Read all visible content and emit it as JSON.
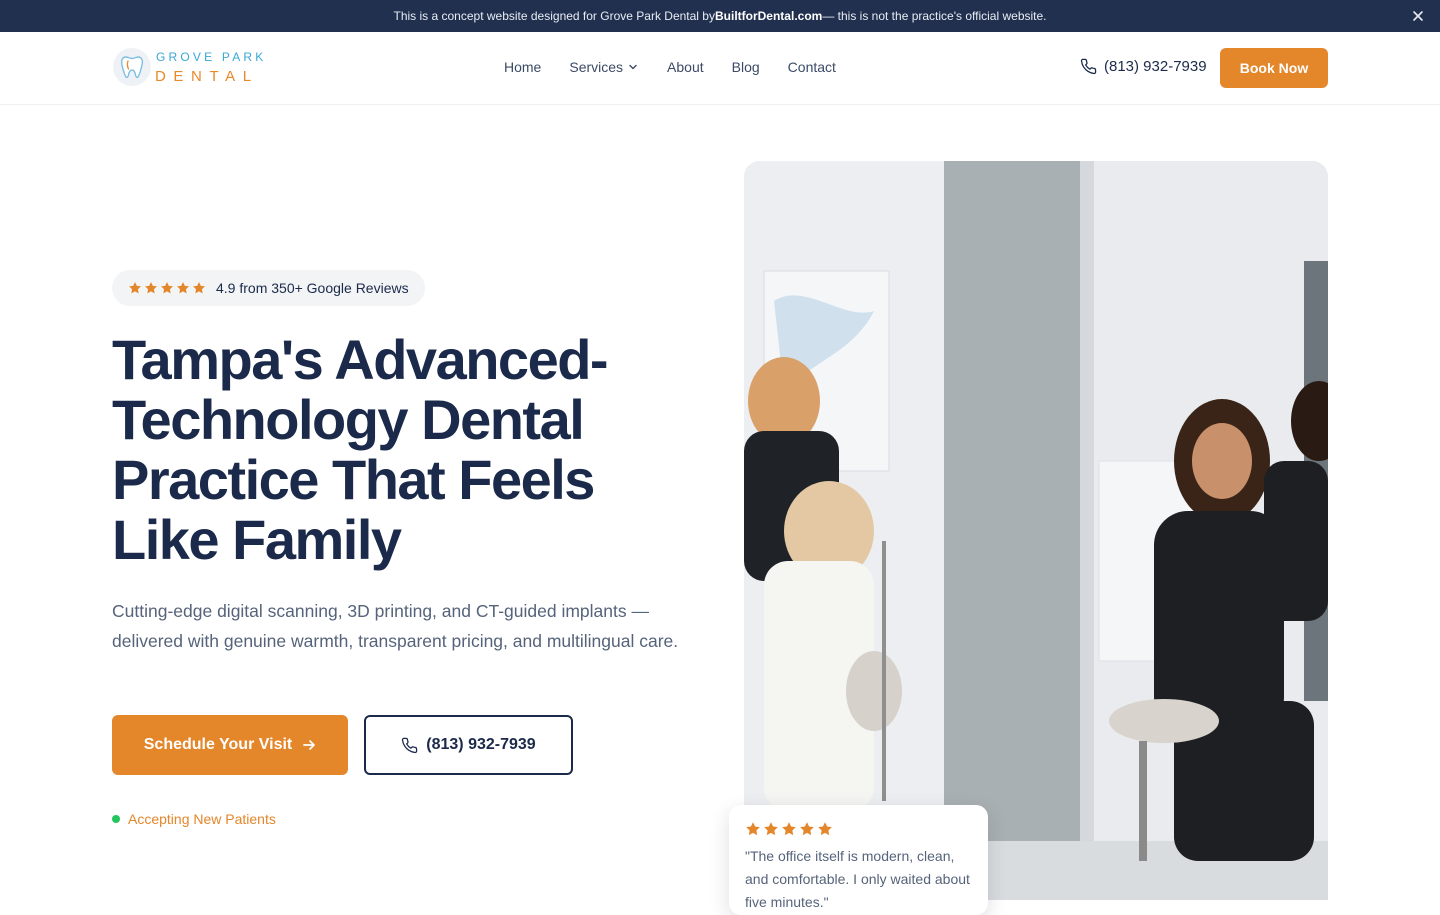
{
  "banner": {
    "text_before": "This is a concept website designed for Grove Park Dental by ",
    "brand": "BuiltforDental.com",
    "text_after": " — this is not the practice's official website."
  },
  "logo": {
    "top": "GROVE PARK",
    "bottom": "DENTAL"
  },
  "nav": {
    "items": [
      "Home",
      "Services",
      "About",
      "Blog",
      "Contact"
    ]
  },
  "header": {
    "phone": "(813) 932-7939",
    "book_label": "Book Now"
  },
  "hero": {
    "rating_text": "4.9 from 350+ Google Reviews",
    "rating_stars": 5,
    "title": "Tampa's Advanced-Technology Dental Practice That Feels Like Family",
    "subtitle": "Cutting-edge digital scanning, 3D printing, and CT-guided implants — delivered with genuine warmth, transparent pricing, and multilingual care.",
    "cta_primary": "Schedule Your Visit",
    "cta_phone": "(813) 932-7939",
    "accepting": "Accepting New Patients"
  },
  "review": {
    "stars": 5,
    "quote": "\"The office itself is modern, clean, and comfortable. I only waited about five minutes.\""
  },
  "colors": {
    "navy": "#1b2a4a",
    "accent_orange": "#e4862a",
    "banner_bg": "#22304f",
    "status_green": "#22c55e",
    "logo_blue": "#3aa7d6"
  }
}
